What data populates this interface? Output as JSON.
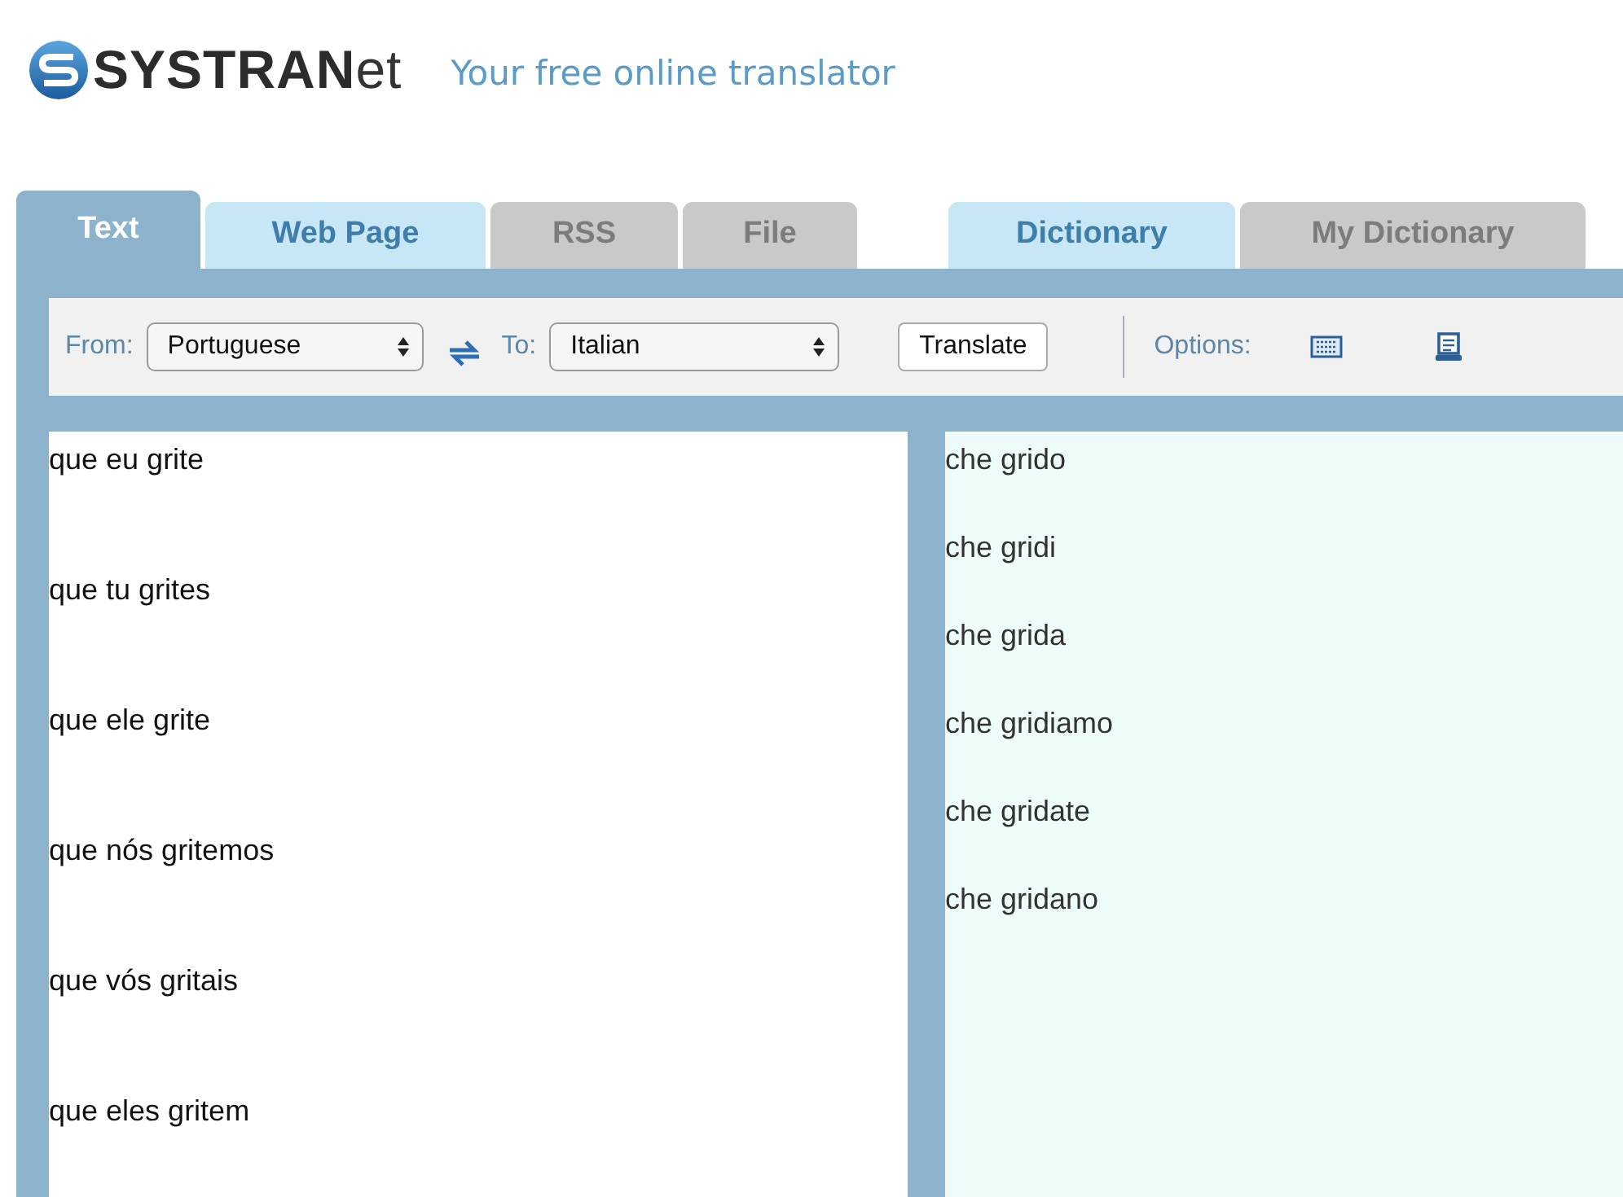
{
  "header": {
    "logo_text": "**SYSTRAN**et",
    "tagline": "Your free online translator"
  },
  "tab_groups": [
    {
      "tabs": [
        {
          "label": "Text",
          "selected": true,
          "disabled": false
        },
        {
          "label": "Web Page",
          "selected": false,
          "disabled": false
        },
        {
          "label": "RSS",
          "selected": false,
          "disabled": true
        },
        {
          "label": "File",
          "selected": false,
          "disabled": true
        }
      ]
    },
    {
      "tabs": [
        {
          "label": "Dictionary",
          "selected": false,
          "disabled": false
        },
        {
          "label": "My Dictionary",
          "selected": false,
          "disabled": true
        }
      ]
    }
  ],
  "toolbar": {
    "from_label": "From:",
    "from_value": "Portuguese",
    "to_label": "To:",
    "to_value": "Italian",
    "translate_button": "Translate",
    "options_label": "Options:"
  },
  "source_lines": [
    "que eu grite",
    "que tu grites",
    "que ele grite",
    "que nós gritemos",
    "que vós gritais",
    "que eles gritem"
  ],
  "target_lines": [
    "che grido",
    "che gridi",
    "che grida",
    "che gridiamo",
    "che gridate",
    "che gridano"
  ]
}
